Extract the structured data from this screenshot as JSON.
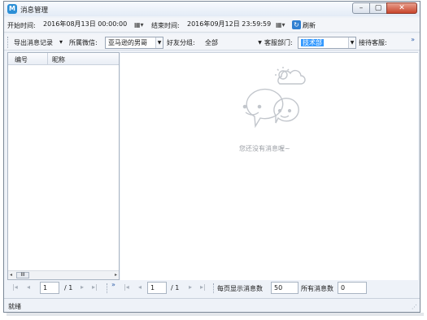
{
  "window": {
    "title": "消息管理",
    "app_icon": "M"
  },
  "controls": {
    "minimize": "–",
    "maximize": "▢",
    "close": "✕"
  },
  "toolbar1": {
    "start_label": "开始时间:",
    "start_value": "2016年08月13日 00:00:00",
    "end_label": "结束时间:",
    "end_value": "2016年09月12日 23:59:59",
    "refresh_label": "刷新"
  },
  "toolbar2": {
    "export_label": "导出消息记录",
    "wechat_label": "所属微信:",
    "wechat_value": "亚马逊的男哥",
    "group_label": "好友分组:",
    "group_value": "全部",
    "dept_label": "客服部门:",
    "dept_value": "技术部",
    "agent_label": "接待客服:",
    "overflow": "»"
  },
  "grid": {
    "columns": [
      "编号",
      "昵称"
    ],
    "scroll_thumb": "III"
  },
  "empty_state": {
    "text": "您还没有消息喔~"
  },
  "pager_left": {
    "page": "1",
    "total": "/ 1",
    "overflow": "»"
  },
  "pager_right": {
    "page": "1",
    "total": "/ 1",
    "per_page_label": "每页显示消息数",
    "per_page_value": "50",
    "total_label": "所有消息数",
    "total_value": "0"
  },
  "status": {
    "text": "就绪"
  }
}
